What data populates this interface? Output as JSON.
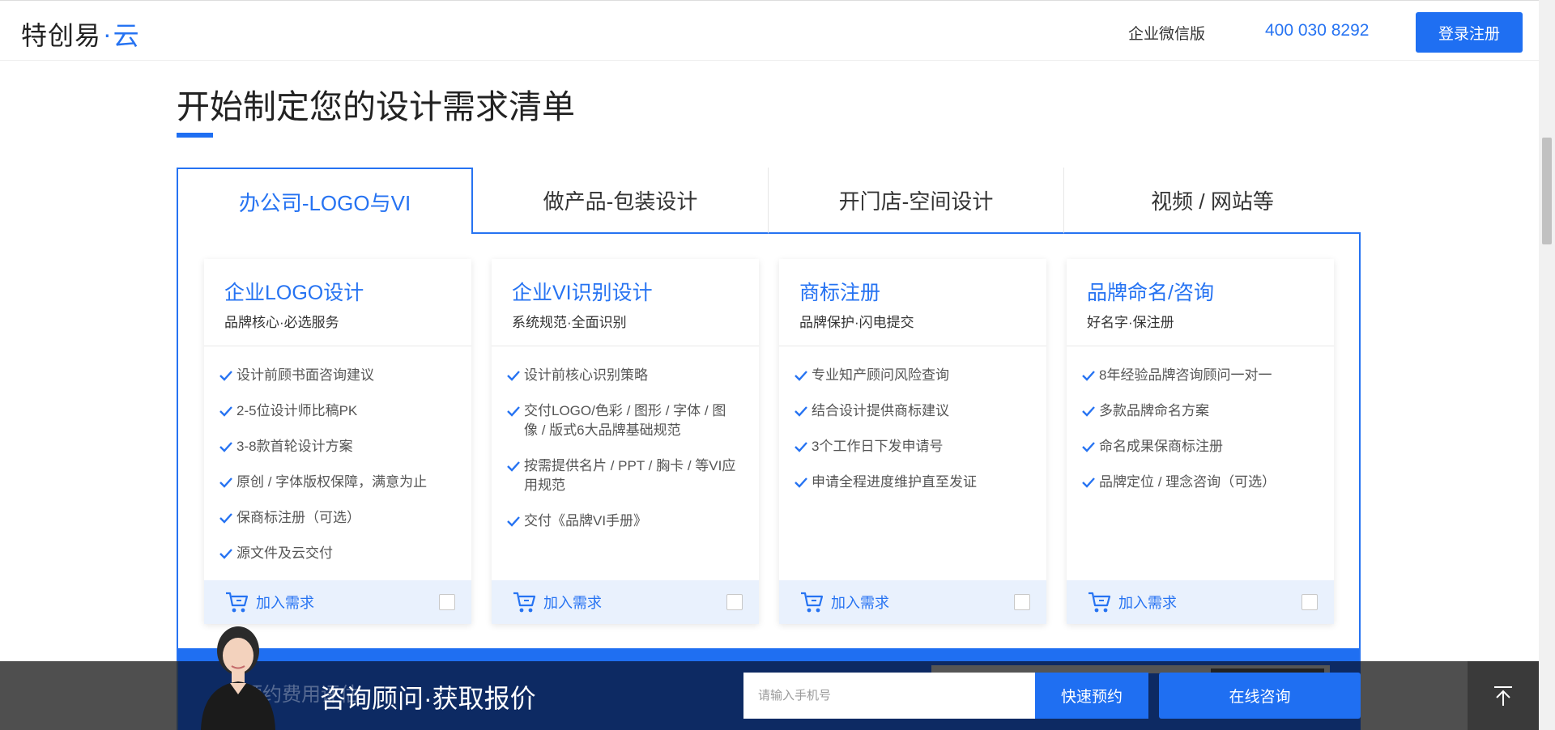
{
  "header": {
    "logo_main": "特创易",
    "logo_dot": "·",
    "logo_cloud": "云",
    "wechat_label": "企业微信版",
    "phone": "400 030 8292",
    "login_label": "登录注册"
  },
  "section": {
    "title": "开始制定您的设计需求清单"
  },
  "tabs": [
    {
      "label": "办公司-LOGO与VI",
      "active": true
    },
    {
      "label": "做产品-包装设计",
      "active": false
    },
    {
      "label": "开门店-空间设计",
      "active": false
    },
    {
      "label": "视频 / 网站等",
      "active": false
    }
  ],
  "cards": [
    {
      "title": "企业LOGO设计",
      "subtitle": "品牌核心·必选服务",
      "features": [
        "设计前顾书面咨询建议",
        "2-5位设计师比稿PK",
        "3-8款首轮设计方案",
        "原创 / 字体版权保障，满意为止",
        "保商标注册（可选）",
        "源文件及云交付"
      ]
    },
    {
      "title": "企业VI识别设计",
      "subtitle": "系统规范·全面识别",
      "features": [
        "设计前核心识别策略",
        "交付LOGO/色彩 / 图形 / 字体 / 图像 / 版式6大品牌基础规范",
        "按需提供名片 / PPT / 胸卡 / 等VI应用规范",
        "交付《品牌VI手册》"
      ]
    },
    {
      "title": "商标注册",
      "subtitle": "品牌保护·闪电提交",
      "features": [
        "专业知产顾问风险查询",
        "结合设计提供商标建议",
        "3个工作日下发申请号",
        "申请全程进度维护直至发证"
      ]
    },
    {
      "title": "品牌命名/咨询",
      "subtitle": "好名字·保注册",
      "features": [
        "8年经验品牌咨询顾问一对一",
        "多款品牌命名方案",
        "命名成果保商标注册",
        "品牌定位 / 理念咨询（可选）"
      ]
    }
  ],
  "card_footer": {
    "add_label": "加入需求"
  },
  "bottom_bar": {
    "ghost_text": "预约费用评估",
    "consult_text": "咨询顾问·获取报价",
    "phone_placeholder": "请输入手机号",
    "quick_label": "快速预约",
    "online_label": "在线咨询"
  },
  "colors": {
    "accent": "#1f6ff2",
    "link": "#2673f2",
    "card_footer_bg": "#e9f1fd",
    "bottom_dark": "#0d2a63"
  },
  "icons": [
    "check-icon",
    "cart-icon",
    "back-to-top-icon",
    "consultant-avatar"
  ]
}
